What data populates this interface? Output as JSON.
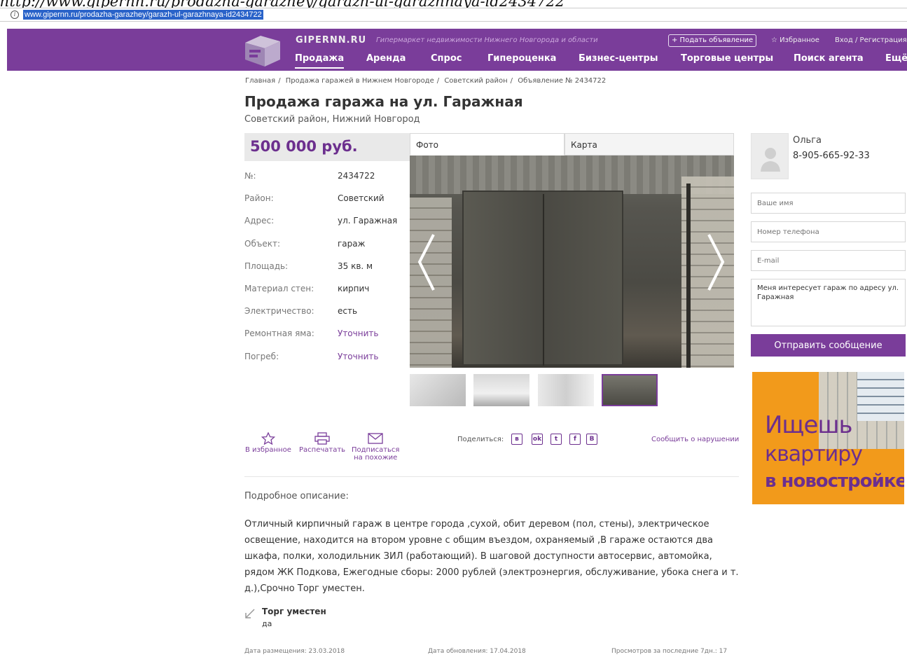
{
  "page_caption": "http://www.gipernn.ru/prodazha-garazhey/garazh-ul-garazhnaya-id2434722",
  "browser": {
    "url": "www.gipernn.ru/prodazha-garazhey/garazh-ul-garazhnaya-id2434722"
  },
  "header": {
    "brand": "GIPERNN.RU",
    "slogan": "Гипермаркет недвижимости Нижнего Новгорода и области",
    "post_ad": "+ Подать объявление",
    "favorites": "☆ Избранное",
    "login": "Вход / Регистрация",
    "nav": [
      "Продажа",
      "Аренда",
      "Спрос",
      "Гипероценка",
      "Бизнес-центры",
      "Торговые центры",
      "Поиск агента",
      "Ещё"
    ]
  },
  "breadcrumbs": [
    "Главная",
    "Продажа гаражей в Нижнем Новгороде",
    "Советский район",
    "Объявление № 2434722"
  ],
  "listing": {
    "title": "Продажа гаража на ул. Гаражная",
    "subtitle": "Советский район, Нижний Новгород",
    "price": "500 000 руб.",
    "specs": [
      {
        "label": "№:",
        "value": "2434722"
      },
      {
        "label": "Район:",
        "value": "Советский"
      },
      {
        "label": "Адрес:",
        "value": "ул. Гаражная"
      },
      {
        "label": "Объект:",
        "value": "гараж"
      },
      {
        "label": "Площадь:",
        "value": "35 кв. м"
      },
      {
        "label": "Материал стен:",
        "value": "кирпич"
      },
      {
        "label": "Электричество:",
        "value": "есть"
      },
      {
        "label": "Ремонтная яма:",
        "value": "Уточнить"
      },
      {
        "label": "Погреб:",
        "value": "Уточнить"
      }
    ]
  },
  "media_tabs": {
    "photo": "Фото",
    "map": "Карта"
  },
  "actions": {
    "favorite": "В избранное",
    "print": "Распечатать",
    "subscribe_1": "Подписаться",
    "subscribe_2": "на похожие",
    "share_label": "Поделиться:",
    "report": "Сообщить о нарушении"
  },
  "share_icons": [
    "vk",
    "ok",
    "tw",
    "fb",
    "B"
  ],
  "description": {
    "heading": "Подробное описание:",
    "text": "Отличный кирпичный гараж в центре города ,сухой, обит деревом (пол, стены), электрическое освещение, находится на втором уровне с общим въездом, охраняемый ,В гараже остаются два шкафа, полки, холодильник ЗИЛ (работающий). В шаговой доступности автосервис, автомойка, рядом ЖК Подкова, Ежегодные сборы: 2000 рублей (электроэнергия, обслуживание, убока снега и т. д.),Срочно Торг уместен."
  },
  "bargain": {
    "title": "Торг уместен",
    "value": "да"
  },
  "footer": {
    "posted": "Дата размещения: 23.03.2018",
    "updated": "Дата обновления: 17.04.2018",
    "views": "Просмотров за последние 7дн.: 17"
  },
  "agent": {
    "name": "Ольга",
    "phone": "8-905-665-92-33"
  },
  "contact_form": {
    "name_placeholder": "Ваше имя",
    "phone_placeholder": "Номер телефона",
    "email_placeholder": "E-mail",
    "message": "Меня интересует гараж по адресу ул. Гаражная",
    "send": "Отправить сообщение"
  },
  "banner": {
    "line1": "Ищешь",
    "line2": "квартиру",
    "line3": "в новостройке?"
  },
  "colors": {
    "brand_purple": "#7a3d9a",
    "banner_orange": "#f29a1b"
  }
}
